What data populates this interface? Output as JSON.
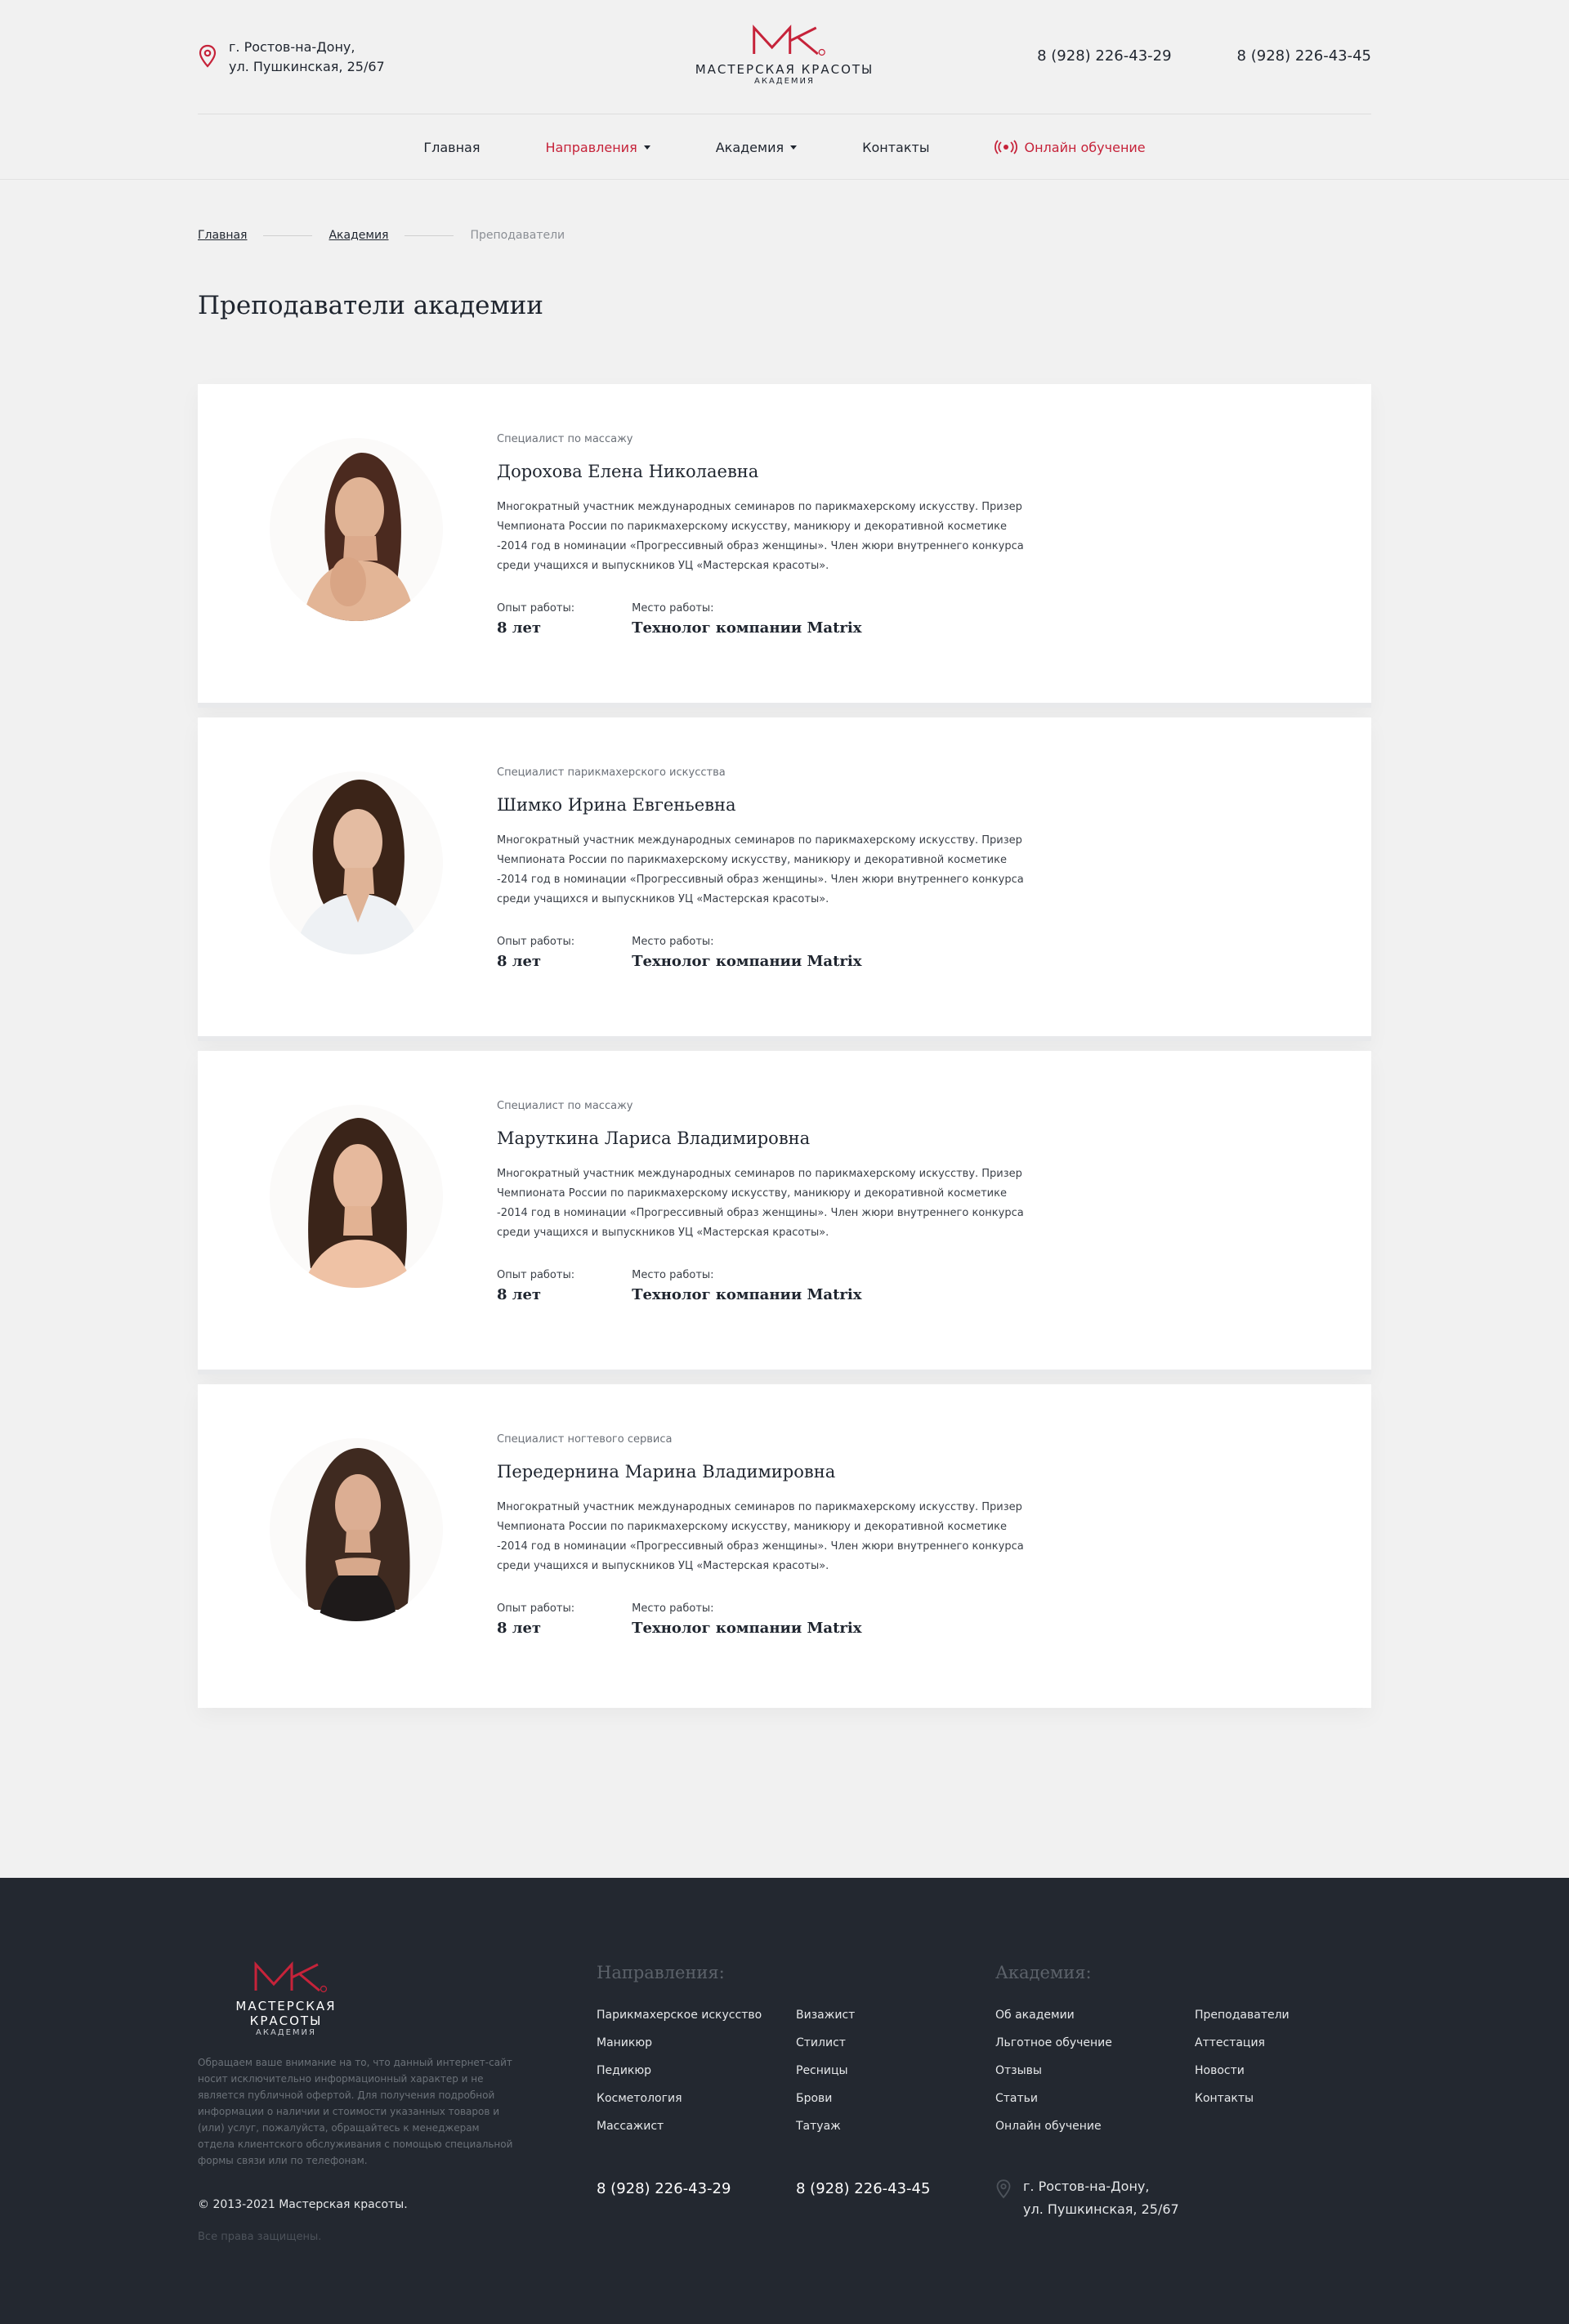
{
  "header": {
    "address_line1": "г. Ростов-на-Дону,",
    "address_line2": "ул. Пушкинская, 25/67",
    "logo_name": "МАСТЕРСКАЯ КРАСОТЫ",
    "logo_sub": "АКАДЕМИЯ",
    "phone1": "8 (928) 226-43-29",
    "phone2": "8 (928) 226-43-45",
    "brand_color": "#c6233a"
  },
  "nav": {
    "home": "Главная",
    "directions": "Направления",
    "academy": "Академия",
    "contacts": "Контакты",
    "online": "Онлайн обучение"
  },
  "breadcrumb": {
    "home": "Главная",
    "academy": "Академия",
    "current": "Преподаватели"
  },
  "page_title": "Преподаватели академии",
  "teachers": [
    {
      "spec": "Специалист по массажу",
      "name": "Дорохова Елена Николаевна",
      "desc": "Многократный участник международных семинаров по парикмахерскому искусству. Призер Чемпионата России по парикмахерскому искусству, маникюру и декоративной косметике -2014 год в номинации «Прогрессивный образ женщины». Член жюри внутреннего конкурса среди учащихся и выпускников УЦ «Мастерская красоты».",
      "exp_label": "Опыт работы:",
      "exp": "8 лет",
      "work_label": "Место работы:",
      "work": "Технолог компании Matrix"
    },
    {
      "spec": "Специалист парикмахерского искусства",
      "name": "Шимко Ирина Евгеньевна",
      "desc": "Многократный участник международных семинаров по парикмахерскому искусству. Призер Чемпионата России по парикмахерскому искусству, маникюру и декоративной косметике -2014 год в номинации «Прогрессивный образ женщины». Член жюри внутреннего конкурса среди учащихся и выпускников УЦ «Мастерская красоты».",
      "exp_label": "Опыт работы:",
      "exp": "8 лет",
      "work_label": "Место работы:",
      "work": "Технолог компании Matrix"
    },
    {
      "spec": "Специалист по массажу",
      "name": "Маруткина Лариса Владимировна",
      "desc": "Многократный участник международных семинаров по парикмахерскому искусству. Призер Чемпионата России по парикмахерскому искусству, маникюру и декоративной косметике -2014 год в номинации «Прогрессивный образ женщины». Член жюри внутреннего конкурса среди учащихся и выпускников УЦ «Мастерская красоты».",
      "exp_label": "Опыт работы:",
      "exp": "8 лет",
      "work_label": "Место работы:",
      "work": "Технолог компании Matrix"
    },
    {
      "spec": "Специалист ногтевого сервиса",
      "name": "Передернина Марина Владимировна",
      "desc": "Многократный участник международных семинаров по парикмахерскому искусству. Призер Чемпионата России по парикмахерскому искусству, маникюру и декоративной косметике -2014 год в номинации «Прогрессивный образ женщины». Член жюри внутреннего конкурса среди учащихся и выпускников УЦ «Мастерская красоты».",
      "exp_label": "Опыт работы:",
      "exp": "8 лет",
      "work_label": "Место работы:",
      "work": "Технолог компании Matrix"
    }
  ],
  "footer": {
    "logo_name": "МАСТЕРСКАЯ КРАСОТЫ",
    "logo_sub": "АКАДЕМИЯ",
    "note": "Обращаем ваше внимание на то, что данный интернет-сайт носит исключительно информационный характер и не является публичной офертой. Для получения подробной информации о наличии и стоимости указанных товаров и (или) услуг, пожалуйста, обращайтесь к менеджерам отдела клиентского обслуживания с помощью специальной формы связи или по телефонам.",
    "copyright": "© 2013-2021 Мастерская красоты.",
    "rights": "Все права защищены.",
    "directions_title": "Направления:",
    "directions_col1": [
      "Парикмахерское искусство",
      "Маникюр",
      "Педикюр",
      "Косметология",
      "Массажист"
    ],
    "directions_col2": [
      "Визажист",
      "Стилист",
      "Ресницы",
      "Брови",
      "Татуаж"
    ],
    "academy_title": "Академия:",
    "academy_col1": [
      "Об академии",
      "Льготное обучение",
      "Отзывы",
      "Статьи",
      "Онлайн обучение"
    ],
    "academy_col2": [
      "Преподаватели",
      "Аттестация",
      "Новости",
      "Контакты"
    ],
    "phone1": "8 (928) 226-43-29",
    "phone2": "8 (928) 226-43-45",
    "address_line1": "г. Ростов-на-Дону,",
    "address_line2": "ул. Пушкинская, 25/67"
  }
}
